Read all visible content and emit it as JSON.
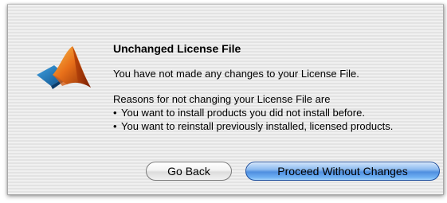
{
  "dialog": {
    "title": "Unchanged License File",
    "message": "You have not made any changes to your License File.",
    "reasons_title": "Reasons for not changing your License File are",
    "bullets": [
      "You want to install products you did not install before.",
      "You want to reinstall previously installed, licensed products."
    ],
    "bullet_symbol": "•",
    "icon": "matlab-logo-icon",
    "buttons": {
      "back_label": "Go Back",
      "proceed_label": "Proceed Without Changes"
    },
    "colors": {
      "default_button": "#5a98e6",
      "logo_orange": "#e8701a",
      "logo_blue": "#1f6fb2"
    }
  }
}
